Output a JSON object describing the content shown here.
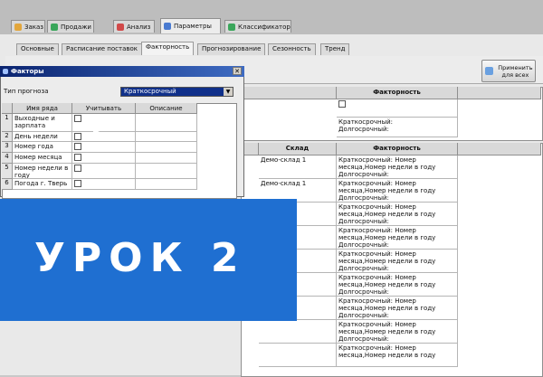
{
  "top_tabs": [
    {
      "label": "Заказ",
      "color": "#e2a63c"
    },
    {
      "label": "Продажи",
      "color": "#3aa65b"
    },
    {
      "label": "Анализ",
      "color": "#d14a4a"
    },
    {
      "label": "Параметры",
      "color": "#4a7bd1"
    },
    {
      "label": "Классификатор",
      "color": "#3aa65b"
    }
  ],
  "sub_tabs": [
    "Основные",
    "Расписание поставок",
    "Факторность",
    "Прогнозирование",
    "Сезонность",
    "Тренд"
  ],
  "apply_button": "Применить для всех",
  "upper_grid": {
    "header": "Факторность",
    "rows": [
      "",
      "Краткосрочный:\nДолгосрочный:"
    ]
  },
  "lower_grid": {
    "headers": [
      "Склад",
      "Факторность"
    ],
    "rows": [
      {
        "store": "Демо-склад 1",
        "factor": "Краткосрочный: Номер месяца,Номер недели в году\nДолгосрочный:"
      },
      {
        "store": "Демо-склад 1",
        "factor": "Краткосрочный: Номер месяца,Номер недели в году\nДолгосрочный:"
      },
      {
        "store": "",
        "factor": "Краткосрочный: Номер месяца,Номер недели в году\nДолгосрочный:"
      },
      {
        "store": "",
        "factor": "Краткосрочный: Номер месяца,Номер недели в году\nДолгосрочный:"
      },
      {
        "store": "",
        "factor": "Краткосрочный: Номер месяца,Номер недели в году\nДолгосрочный:"
      },
      {
        "store": "",
        "factor": "Краткосрочный: Номер месяца,Номер недели в году\nДолгосрочный:"
      },
      {
        "store": "",
        "factor": "Краткосрочный: Номер месяца,Номер недели в году\nДолгосрочный:"
      },
      {
        "store": "",
        "factor": "Краткосрочный: Номер месяца,Номер недели в году\nДолгосрочный:"
      },
      {
        "store": "",
        "factor": "Краткосрочный: Номер месяца,Номер недели в году"
      }
    ]
  },
  "dialog": {
    "title": "Факторы",
    "forecast_type_label": "Тип прогноза",
    "forecast_type_value": "Краткосрочный",
    "columns": [
      "Имя ряда",
      "Учитывать",
      "Описание"
    ],
    "rows": [
      {
        "n": "1",
        "name": "Выходные и зарплата"
      },
      {
        "n": "2",
        "name": "День недели"
      },
      {
        "n": "3",
        "name": "Номер года"
      },
      {
        "n": "4",
        "name": "Номер месяца"
      },
      {
        "n": "5",
        "name": "Номер недели в году"
      },
      {
        "n": "6",
        "name": "Погода г. Тверь"
      }
    ]
  },
  "banner": {
    "text": "УРОК 2",
    "color": "#1f6fd1"
  }
}
